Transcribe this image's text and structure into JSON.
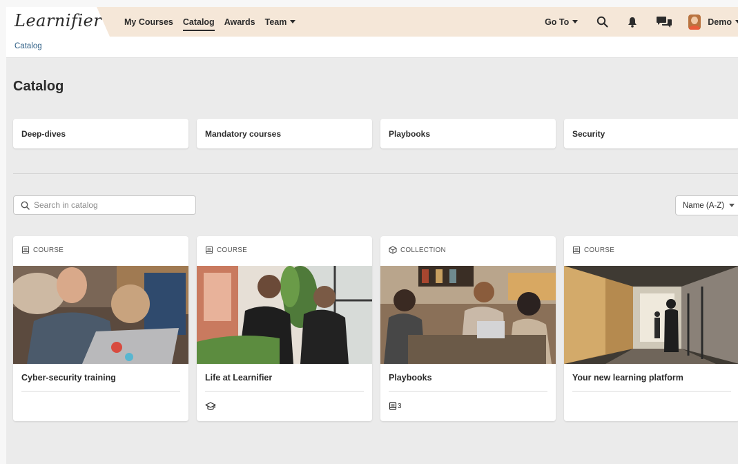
{
  "app": {
    "logo_text": "Learnifier"
  },
  "nav": {
    "items": [
      {
        "label": "My Courses"
      },
      {
        "label": "Catalog",
        "active": true
      },
      {
        "label": "Awards"
      },
      {
        "label": "Team",
        "has_dropdown": true
      }
    ],
    "goto_label": "Go To",
    "user_name": "Demo",
    "icons": [
      "search-icon",
      "bell-icon",
      "chat-icon"
    ]
  },
  "breadcrumb": {
    "items": [
      "Catalog"
    ]
  },
  "page": {
    "title": "Catalog"
  },
  "categories": [
    {
      "label": "Deep-dives"
    },
    {
      "label": "Mandatory courses"
    },
    {
      "label": "Playbooks"
    },
    {
      "label": "Security"
    }
  ],
  "search": {
    "placeholder": "Search in catalog",
    "value": ""
  },
  "sort": {
    "selected": "Name (A-Z)"
  },
  "cards": [
    {
      "type_label": "COURSE",
      "type_icon": "course-icon",
      "title": "Cyber-security training",
      "meta": ""
    },
    {
      "type_label": "COURSE",
      "type_icon": "course-icon",
      "title": "Life at Learnifier",
      "meta_icon": "graduation-cap-icon",
      "meta": ""
    },
    {
      "type_label": "COLLECTION",
      "type_icon": "collection-icon",
      "title": "Playbooks",
      "meta_icon": "course-icon",
      "meta": "3"
    },
    {
      "type_label": "COURSE",
      "type_icon": "course-icon",
      "title": "Your new learning platform",
      "meta": ""
    }
  ],
  "colors": {
    "topbar": "#f5e7d8",
    "background": "#ebebeb",
    "link": "#2c5d84"
  }
}
